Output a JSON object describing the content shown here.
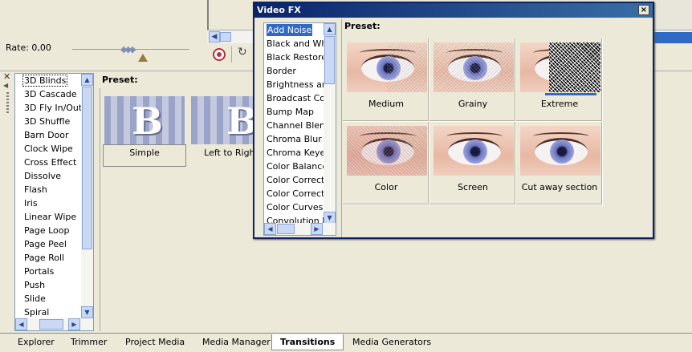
{
  "rate": {
    "label": "Rate: 0,00"
  },
  "transitions_panel": {
    "preset_label": "Preset:",
    "items": [
      "3D Blinds",
      "3D Cascade",
      "3D Fly In/Out",
      "3D Shuffle",
      "Barn Door",
      "Clock Wipe",
      "Cross Effect",
      "Dissolve",
      "Flash",
      "Iris",
      "Linear Wipe",
      "Page Loop",
      "Page Peel",
      "Page Roll",
      "Portals",
      "Push",
      "Slide",
      "Spiral"
    ],
    "selected": "3D Blinds",
    "presets": [
      {
        "label": "Simple"
      },
      {
        "label": "Left to Right"
      }
    ]
  },
  "tabs": [
    "Explorer",
    "Trimmer",
    "Project Media",
    "Media Manager",
    "Transitions",
    "Media Generators"
  ],
  "active_tab": "Transitions",
  "video_fx": {
    "title": "Video FX",
    "close_label": "×",
    "preset_label": "Preset:",
    "items": [
      "Add Noise",
      "Black and White",
      "Black Restore",
      "Border",
      "Brightness and Contrast",
      "Broadcast Colors",
      "Bump Map",
      "Channel Blend",
      "Chroma Blur",
      "Chroma Keyer",
      "Color Balance",
      "Color Corrector",
      "Color Corrector (Secondary)",
      "Color Curves",
      "Convolution Kernel"
    ],
    "selected": "Add Noise",
    "presets": [
      {
        "label": "Medium",
        "noise": "half"
      },
      {
        "label": "Grainy",
        "noise": "full"
      },
      {
        "label": "Extreme",
        "noise": "extreme"
      },
      {
        "label": "Color",
        "noise": "color"
      },
      {
        "label": "Screen",
        "noise": "none"
      },
      {
        "label": "Cut away section",
        "noise": "none"
      }
    ],
    "selected_preset": "Extreme"
  }
}
